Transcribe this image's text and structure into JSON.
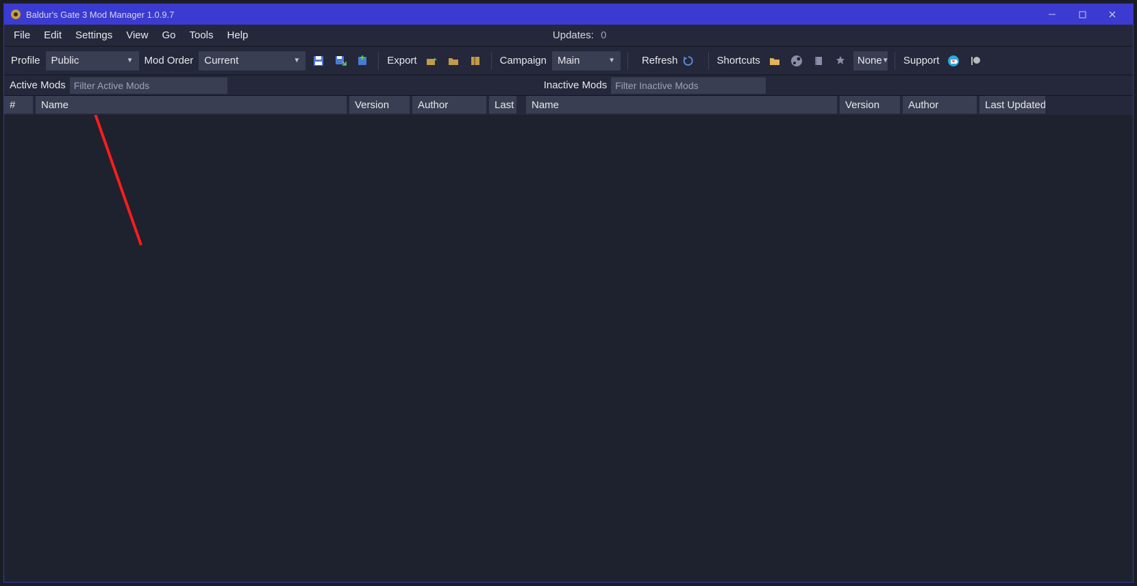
{
  "titlebar": {
    "title": "Baldur's Gate 3 Mod Manager 1.0.9.7"
  },
  "menu": {
    "file": "File",
    "edit": "Edit",
    "settings": "Settings",
    "view": "View",
    "go": "Go",
    "tools": "Tools",
    "help": "Help",
    "updates_label": "Updates:",
    "updates_count": "0"
  },
  "toolbar": {
    "profile_label": "Profile",
    "profile_value": "Public",
    "modorder_label": "Mod Order",
    "modorder_value": "Current",
    "export_label": "Export",
    "campaign_label": "Campaign",
    "campaign_value": "Main",
    "refresh_label": "Refresh",
    "shortcuts_label": "Shortcuts",
    "none_label": "None",
    "support_label": "Support"
  },
  "filter": {
    "active_label": "Active Mods",
    "active_placeholder": "Filter Active Mods",
    "inactive_label": "Inactive Mods",
    "inactive_placeholder": "Filter Inactive Mods"
  },
  "headers": {
    "num": "#",
    "name": "Name",
    "version": "Version",
    "author": "Author",
    "last_u": "Last U",
    "last_updated": "Last Updated"
  }
}
